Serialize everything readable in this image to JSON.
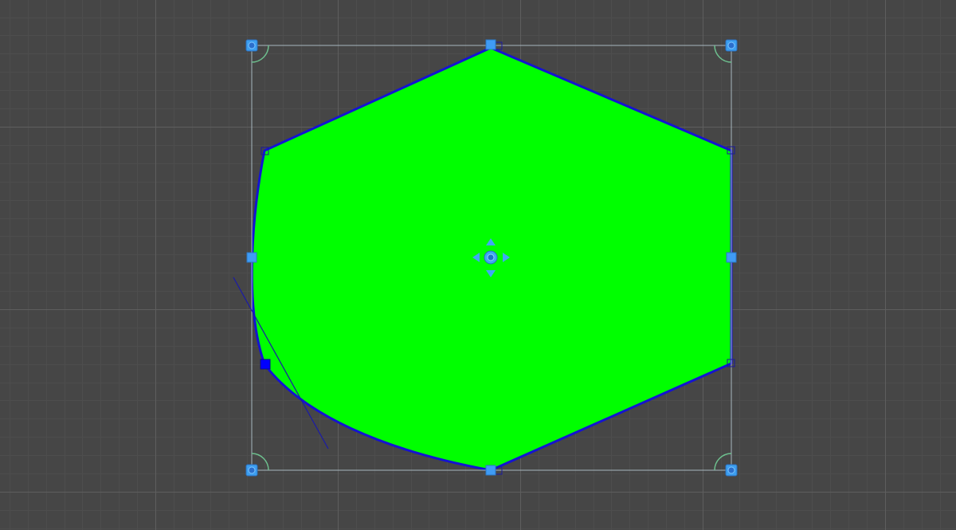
{
  "scene": {
    "background_color": "#464646",
    "major_grid_color": "#5e5e5e",
    "minor_grid_color": "#4d4d4d",
    "grid_visible": true
  },
  "sprite_shape": {
    "fill_color": "#00ff00",
    "outline_color": "#1414d2",
    "shape": "hexagon",
    "edited_vertex": "lower-left",
    "edited_vertex_mode": "bezier-tangent"
  },
  "rect_tool": {
    "frame_color": "#a6b6bd",
    "handle_color": "#3f9bf5",
    "pivot_color": "#3c9ff0",
    "rotation_arc_color": "#6dbf8e",
    "move_arrows_color": "#3fa8f5"
  }
}
